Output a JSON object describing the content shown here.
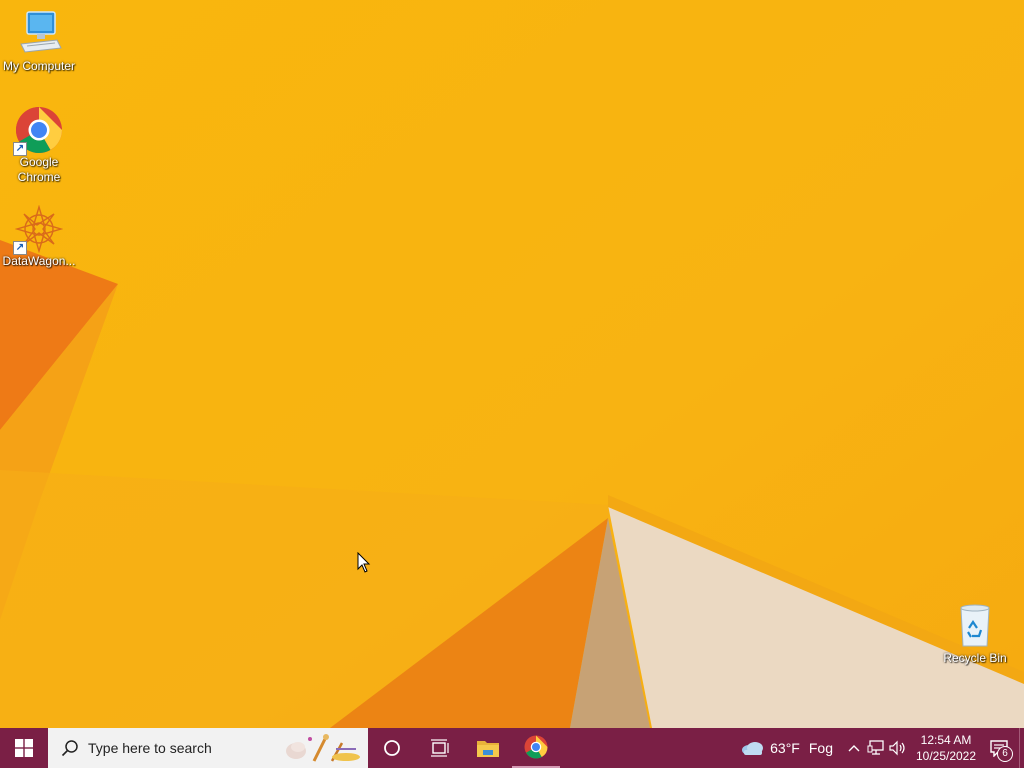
{
  "desktop": {
    "background_color": "#f8b410",
    "icons": [
      {
        "label": "My Computer",
        "icon": "computer-icon"
      },
      {
        "label_line1": "Google",
        "label_line2": "Chrome",
        "icon": "chrome-icon"
      },
      {
        "label": "DataWagon...",
        "icon": "datawagon-icon"
      },
      {
        "label": "Recycle Bin",
        "icon": "recycle-bin-icon"
      }
    ]
  },
  "taskbar": {
    "color": "#7a1f45",
    "search_placeholder": "Type here to search",
    "pinned": [
      {
        "icon": "cortana-icon"
      },
      {
        "icon": "task-view-icon"
      },
      {
        "icon": "file-explorer-icon"
      },
      {
        "icon": "chrome-icon"
      }
    ],
    "weather": {
      "temperature": "63°F",
      "condition": "Fog",
      "icon": "cloud-icon"
    },
    "clock": {
      "time": "12:54 AM",
      "date": "10/25/2022"
    },
    "notification_count": "6"
  }
}
